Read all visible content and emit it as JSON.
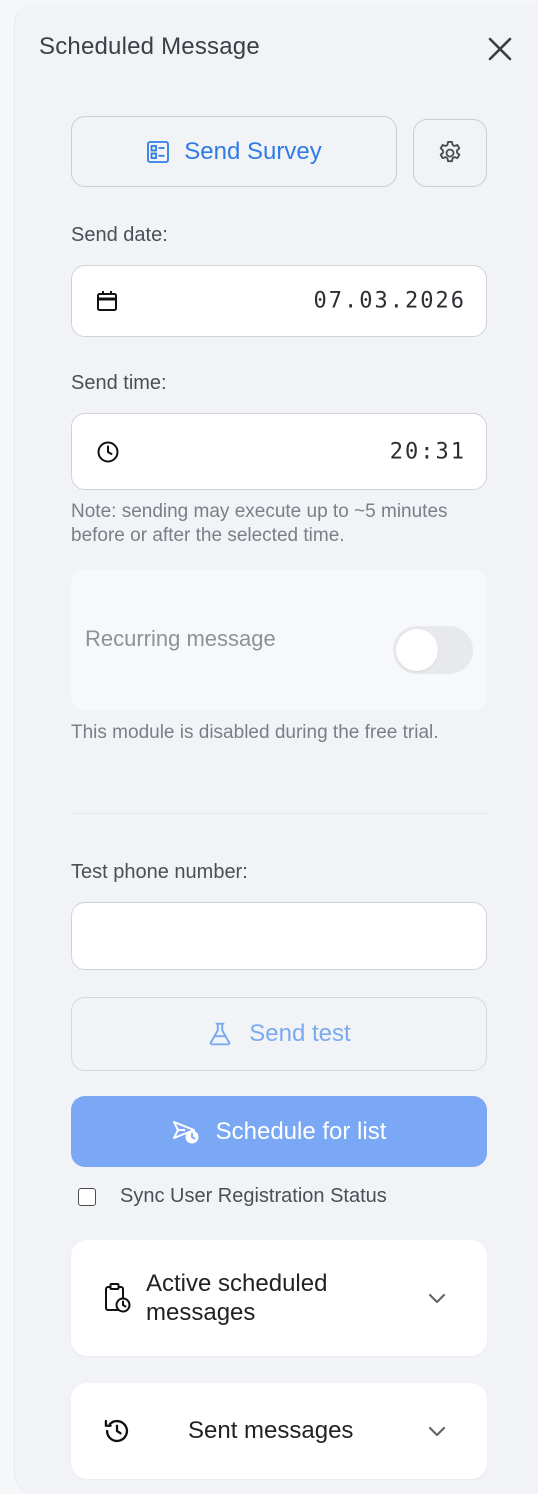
{
  "header": {
    "title": "Scheduled Message"
  },
  "survey_button": {
    "label": "Send Survey"
  },
  "send_date": {
    "label": "Send date:",
    "value": "07.03.2026"
  },
  "send_time": {
    "label": "Send time:",
    "value": "20:31"
  },
  "timing_note": "Note: sending may execute up to ~5 minutes before or after the selected time.",
  "recurring": {
    "label": "Recurring message",
    "enabled": false,
    "note": "This module is disabled during the free trial."
  },
  "test_phone": {
    "label": "Test phone number:",
    "value": "",
    "placeholder": ""
  },
  "send_test_button": {
    "label": "Send test"
  },
  "schedule_button": {
    "label": "Schedule for list"
  },
  "sync": {
    "label": "Sync User Registration Status",
    "checked": false
  },
  "active_card": {
    "label": "Active scheduled messages"
  },
  "sent_card": {
    "label": "Sent messages"
  },
  "colors": {
    "accent": "#2f7be6",
    "schedule_bg": "#7aa8f4",
    "panel_bg": "#f1f3f7"
  },
  "icons": [
    "close-icon",
    "survey-list-icon",
    "gear-icon",
    "calendar-icon",
    "clock-icon",
    "flask-icon",
    "send-schedule-icon",
    "clipboard-clock-icon",
    "history-icon",
    "chevron-down-icon"
  ]
}
